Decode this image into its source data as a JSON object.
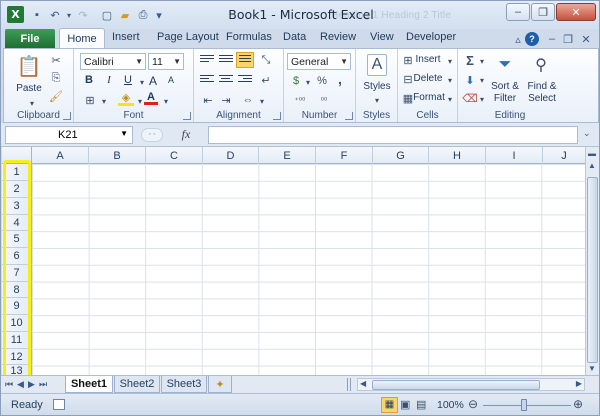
{
  "window": {
    "title": "Book1 - Microsoft Excel",
    "ghost_text": "Heading 1    Heading 2    Title",
    "logo_letter": "X"
  },
  "tabs": {
    "file": "File",
    "items": [
      "Home",
      "Insert",
      "Page Layout",
      "Formulas",
      "Data",
      "Review",
      "View",
      "Developer"
    ]
  },
  "ribbon": {
    "clipboard": {
      "label": "Clipboard",
      "paste": "Paste"
    },
    "font": {
      "label": "Font",
      "name": "Calibri",
      "size": "11",
      "bold": "B",
      "italic": "I",
      "underline": "U",
      "increase": "A",
      "decrease": "A",
      "font_color": "A"
    },
    "alignment": {
      "label": "Alignment"
    },
    "number": {
      "label": "Number",
      "format": "General",
      "currency": "$",
      "percent": "%",
      "comma": ",",
      "inc_decimal": "+.0​.00",
      "dec_decimal": ".00→.0"
    },
    "styles": {
      "label": "Styles",
      "button": "Styles"
    },
    "cells": {
      "label": "Cells",
      "insert": "Insert",
      "delete": "Delete",
      "format": "Format"
    },
    "editing": {
      "label": "Editing",
      "sum": "Σ",
      "sort": "Sort &",
      "sort2": "Filter",
      "find": "Find &",
      "find2": "Select"
    }
  },
  "formula_bar": {
    "name_box": "K21",
    "fx": "fx",
    "value": ""
  },
  "grid": {
    "columns": [
      "A",
      "B",
      "C",
      "D",
      "E",
      "F",
      "G",
      "H",
      "I",
      "J"
    ],
    "rows": [
      "1",
      "2",
      "3",
      "4",
      "5",
      "6",
      "7",
      "8",
      "9",
      "10",
      "11",
      "12",
      "13"
    ]
  },
  "sheets": [
    "Sheet1",
    "Sheet2",
    "Sheet3"
  ],
  "status": {
    "ready": "Ready",
    "zoom": "100%"
  },
  "colors": {
    "highlight": "#f4ef1a",
    "file_tab": "#1e6f34"
  }
}
